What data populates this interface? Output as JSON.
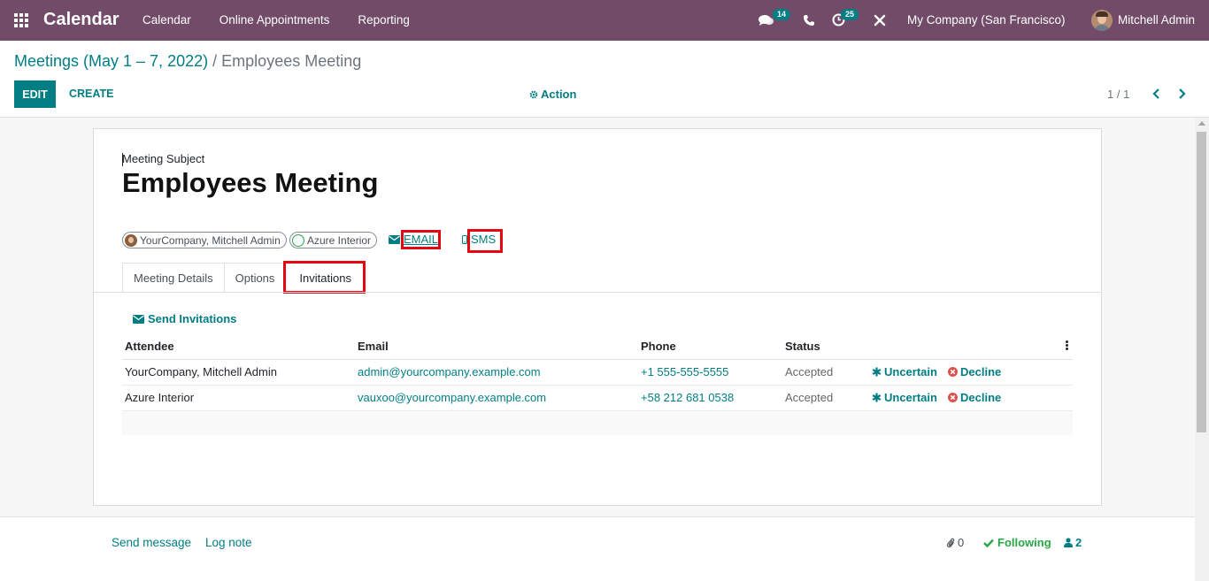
{
  "navbar": {
    "app_name": "Calendar",
    "menu": [
      "Calendar",
      "Online Appointments",
      "Reporting"
    ],
    "messages_count": "14",
    "activities_count": "25",
    "company": "My Company (San Francisco)",
    "user": "Mitchell Admin"
  },
  "breadcrumb": {
    "parent": "Meetings (May 1 – 7, 2022)",
    "separator": "/",
    "current": "Employees Meeting"
  },
  "buttons": {
    "edit": "EDIT",
    "create": "CREATE",
    "action": "Action"
  },
  "pager": {
    "value": "1 / 1"
  },
  "form": {
    "subject_label": "Meeting Subject",
    "subject": "Employees Meeting",
    "attendees": [
      "YourCompany, Mitchell Admin",
      "Azure Interior"
    ],
    "email_label": "EMAIL",
    "sms_label": "SMS"
  },
  "tabs": [
    "Meeting Details",
    "Options",
    "Invitations"
  ],
  "invitations": {
    "send_label": "Send Invitations",
    "columns": [
      "Attendee",
      "Email",
      "Phone",
      "Status"
    ],
    "rows": [
      {
        "attendee": "YourCompany, Mitchell Admin",
        "email": "admin@yourcompany.example.com",
        "phone": "+1 555-555-5555",
        "status": "Accepted",
        "uncertain": "Uncertain",
        "decline": "Decline"
      },
      {
        "attendee": "Azure Interior",
        "email": "vauxoo@yourcompany.example.com",
        "phone": "+58 212 681 0538",
        "status": "Accepted",
        "uncertain": "Uncertain",
        "decline": "Decline"
      }
    ]
  },
  "chatter": {
    "send_message": "Send message",
    "log_note": "Log note",
    "attachments": "0",
    "following": "Following",
    "followers": "2"
  },
  "colors": {
    "navbar": "#714B67",
    "primary": "#017e84",
    "highlight": "#e30613",
    "following": "#28a745"
  }
}
